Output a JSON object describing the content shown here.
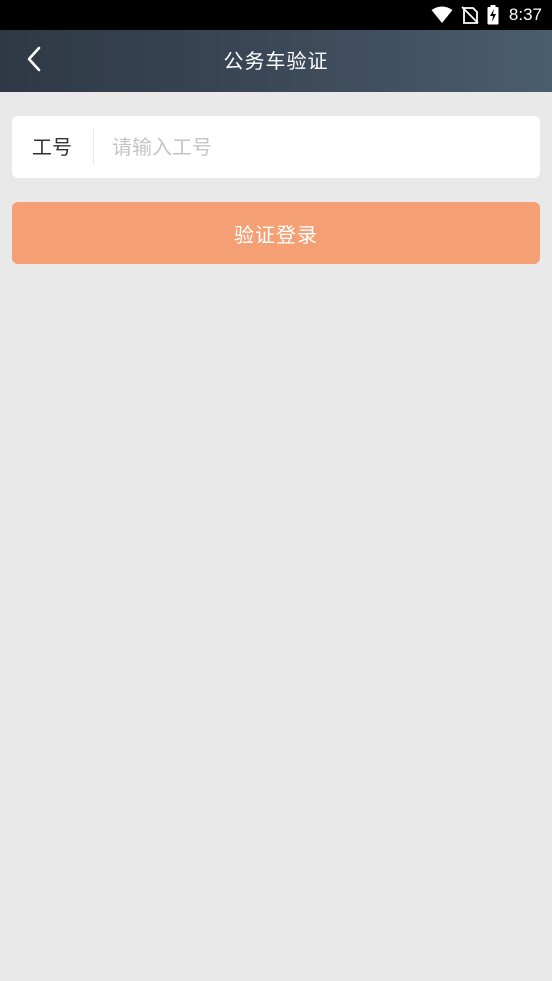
{
  "status_bar": {
    "time": "8:37",
    "icons": [
      "wifi-icon",
      "no-sim-icon",
      "battery-charging-icon"
    ]
  },
  "header": {
    "back_icon": "chevron-left-icon",
    "title": "公务车验证"
  },
  "form": {
    "employee_id_label": "工号",
    "employee_id_placeholder": "请输入工号",
    "employee_id_value": ""
  },
  "actions": {
    "login_label": "验证登录"
  },
  "colors": {
    "status_bar_bg": "#000000",
    "header_gradient_start": "#2f3945",
    "header_gradient_end": "#4a5d6f",
    "page_bg": "#e9e9e9",
    "button_bg": "#f4a074",
    "placeholder": "#c4c4c4"
  }
}
